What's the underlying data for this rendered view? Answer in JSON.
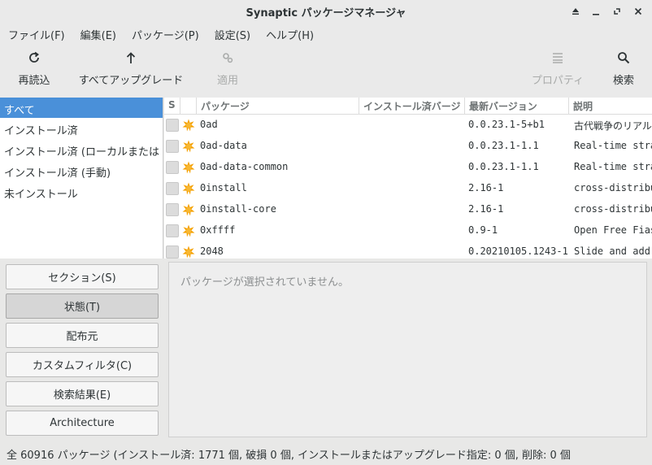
{
  "window": {
    "title": "Synaptic パッケージマネージャ",
    "controls": [
      "eject-icon",
      "minimize-icon",
      "restore-icon",
      "close-icon"
    ]
  },
  "menu": [
    "ファイル(F)",
    "編集(E)",
    "パッケージ(P)",
    "設定(S)",
    "ヘルプ(H)"
  ],
  "toolbar": {
    "reload": "再読込",
    "upgrade_all": "すべてアップグレード",
    "apply": "適用",
    "properties": "プロパティ",
    "search": "検索"
  },
  "filters": [
    "すべて",
    "インストール済",
    "インストール済 (ローカルまたは",
    "インストール済 (手動)",
    "未インストール"
  ],
  "table": {
    "headers": {
      "s": "S",
      "package": "パッケージ",
      "installed_version": "インストール済バージ",
      "latest_version": "最新バージョン",
      "description": "説明"
    },
    "rows": [
      {
        "name": "0ad",
        "installed": "",
        "latest": "0.0.23.1-5+b1",
        "desc": "古代戦争のリアル"
      },
      {
        "name": "0ad-data",
        "installed": "",
        "latest": "0.0.23.1-1.1",
        "desc": "Real-time stra"
      },
      {
        "name": "0ad-data-common",
        "installed": "",
        "latest": "0.0.23.1-1.1",
        "desc": "Real-time stra"
      },
      {
        "name": "0install",
        "installed": "",
        "latest": "2.16-1",
        "desc": "cross-distribu"
      },
      {
        "name": "0install-core",
        "installed": "",
        "latest": "2.16-1",
        "desc": "cross-distribu"
      },
      {
        "name": "0xffff",
        "installed": "",
        "latest": "0.9-1",
        "desc": "Open Free Fias"
      },
      {
        "name": "2048",
        "installed": "",
        "latest": "0.20210105.1243-1",
        "desc": "Slide and add"
      }
    ]
  },
  "left_buttons": {
    "sections": "セクション(S)",
    "status": "状態(T)",
    "origin": "配布元",
    "custom_filters": "カスタムフィルタ(C)",
    "search_results": "検索結果(E)",
    "architecture": "Architecture"
  },
  "details": {
    "message": "パッケージが選択されていません。"
  },
  "status_bar": "全 60916 パッケージ (インストール済: 1771 個, 破損 0 個, インストールまたはアップグレード指定: 0 個, 削除: 0 個"
}
